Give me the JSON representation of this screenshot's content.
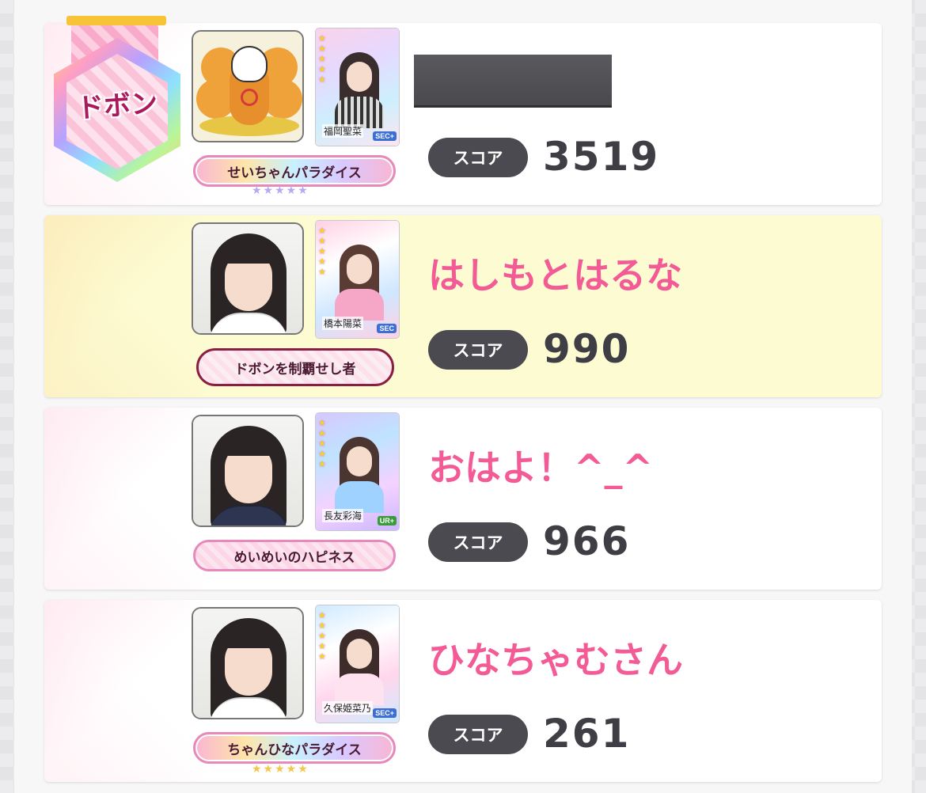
{
  "rows": [
    {
      "name": "",
      "name_redacted": true,
      "score_label": "スコア",
      "score": "3519",
      "badge": "せいちゃんパラダイス",
      "badge_stars": "★★★★★",
      "card_name": "福岡聖菜",
      "card_rarity": "SEC+",
      "medal": "ドボン",
      "highlight": false
    },
    {
      "name": "はしもとはるな",
      "score_label": "スコア",
      "score": "990",
      "badge": "ドボンを制覇せし者",
      "card_name": "橋本陽菜",
      "card_rarity": "SEC",
      "highlight": true
    },
    {
      "name": "おはよ！^_^",
      "score_label": "スコア",
      "score": "966",
      "badge": "めいめいのハピネス",
      "card_name": "長友彩海",
      "card_rarity": "UR+",
      "highlight": false
    },
    {
      "name": "ひなちゃむさん",
      "score_label": "スコア",
      "score": "261",
      "badge": "ちゃんひなパラダイス",
      "badge_stars": "★★★★★",
      "card_name": "久保姫菜乃",
      "card_rarity": "SEC+",
      "highlight": false
    }
  ],
  "colors": {
    "name_pink": "#f25b96",
    "score_dark": "#3e3e44",
    "highlight_row": "#fdfbd2"
  }
}
